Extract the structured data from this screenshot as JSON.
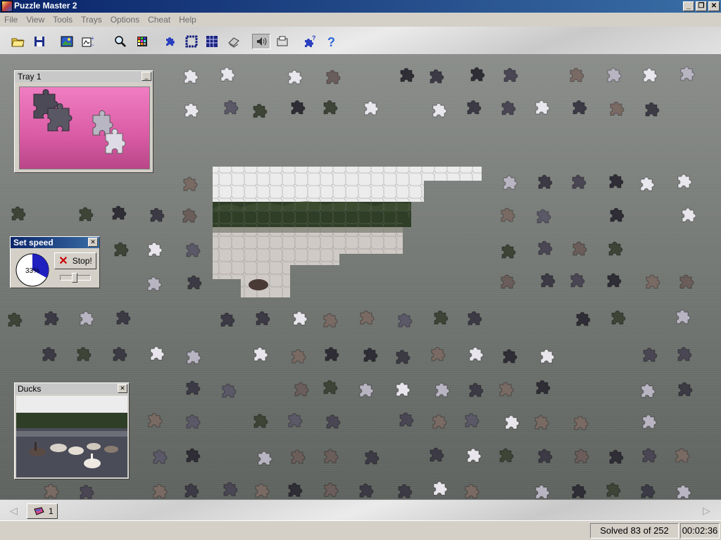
{
  "window": {
    "title": "Puzzle Master 2",
    "minimize": "_",
    "restore": "❐",
    "close": "✕"
  },
  "menu": [
    "File",
    "View",
    "Tools",
    "Trays",
    "Options",
    "Cheat",
    "Help"
  ],
  "toolbar": [
    {
      "name": "open-folder-icon"
    },
    {
      "name": "save-icon"
    },
    {
      "name": "picture-icon"
    },
    {
      "name": "sort-pieces-icon"
    },
    {
      "name": "zoom-icon"
    },
    {
      "name": "color-grid-icon"
    },
    {
      "name": "puzzle-piece-icon"
    },
    {
      "name": "border-pieces-icon"
    },
    {
      "name": "grid-icon"
    },
    {
      "name": "scatter-icon"
    },
    {
      "name": "sound-icon"
    },
    {
      "name": "tray-icon"
    },
    {
      "name": "hint-piece-icon"
    },
    {
      "name": "help-icon"
    }
  ],
  "tray1": {
    "title": "Tray 1",
    "minimize": "_"
  },
  "speed": {
    "title": "Set speed",
    "close": "✕",
    "percent": "33%",
    "percent_value": 33,
    "stop_label": "Stop!"
  },
  "ducks": {
    "title": "Ducks",
    "close": "✕"
  },
  "traybar": {
    "tab_label": "1",
    "left_arrow": "◁",
    "right_arrow": "▷"
  },
  "status": {
    "solved": "Solved 83 of 252",
    "solved_count": 83,
    "total": 252,
    "time": "00:02:36"
  },
  "colors": {
    "title_active": "#0a246a",
    "tray_pink": "#e06aae",
    "sky": "#ececec",
    "trees": "#2b3a22",
    "water": "#c9c4c0"
  }
}
